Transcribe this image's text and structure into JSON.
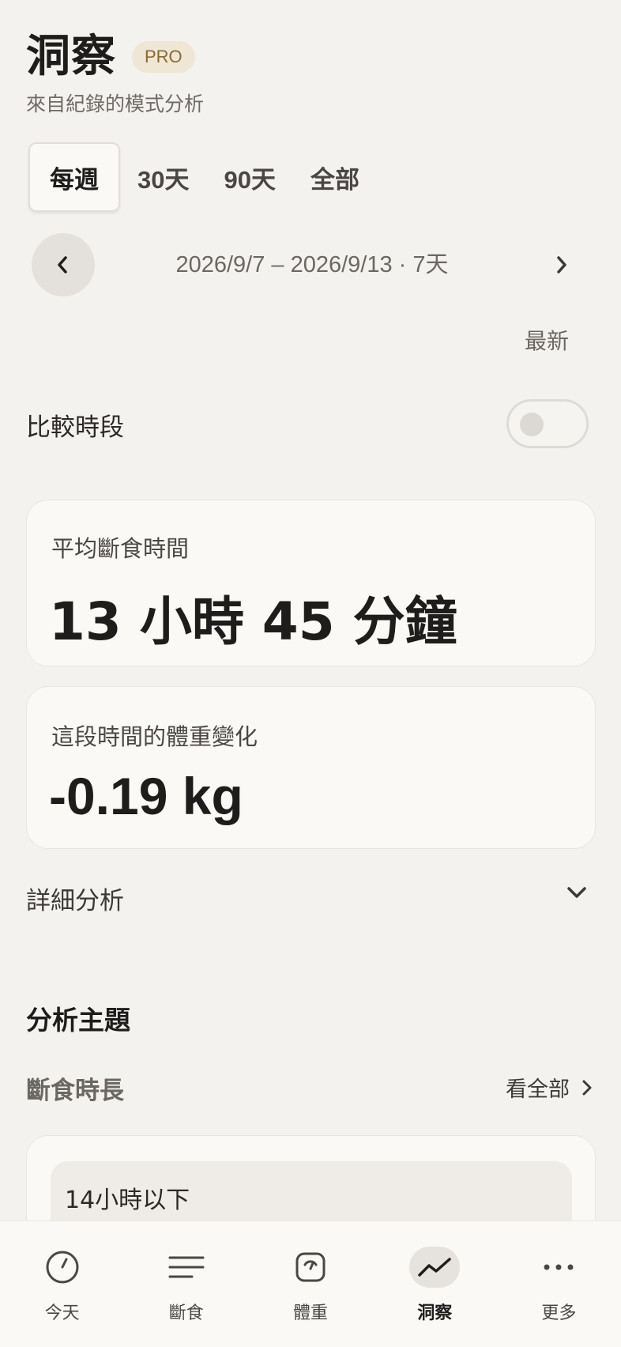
{
  "header": {
    "title": "洞察",
    "badge": "PRO",
    "subtitle": "來自紀錄的模式分析"
  },
  "tabs": [
    {
      "label": "每週",
      "active": true
    },
    {
      "label": "30天",
      "active": false
    },
    {
      "label": "90天",
      "active": false
    },
    {
      "label": "全部",
      "active": false
    }
  ],
  "period": {
    "range": "2026/9/7 – 2026/9/13 · 7天",
    "latest_label": "最新"
  },
  "compare": {
    "label": "比較時段",
    "enabled": false
  },
  "stats": {
    "fasting": {
      "label": "平均斷食時間",
      "value": "13 小時 45 分鐘"
    },
    "weight": {
      "label": "這段時間的體重變化",
      "value": "-0.19 kg"
    }
  },
  "details": {
    "label": "詳細分析"
  },
  "topics": {
    "section_title": "分析主題",
    "current_topic": "斷食時長",
    "see_all": "看全部",
    "first_bucket": "14小時以下"
  },
  "bottom_nav": [
    {
      "label": "今天",
      "icon": "clock-icon",
      "active": false
    },
    {
      "label": "斷食",
      "icon": "list-icon",
      "active": false
    },
    {
      "label": "體重",
      "icon": "scale-icon",
      "active": false
    },
    {
      "label": "洞察",
      "icon": "trend-icon",
      "active": true
    },
    {
      "label": "更多",
      "icon": "more-icon",
      "active": false
    }
  ],
  "colors": {
    "background": "#f4f2ef",
    "card": "#faf9f6",
    "badge_bg": "#efe6d6",
    "badge_text": "#8a6a2f",
    "text_primary": "#1f1d1b",
    "text_secondary": "#6b6762"
  }
}
